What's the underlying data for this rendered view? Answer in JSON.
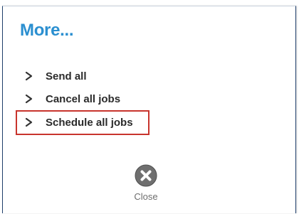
{
  "dialog": {
    "title": "More...",
    "items": [
      {
        "label": "Send all"
      },
      {
        "label": "Cancel all jobs"
      },
      {
        "label": "Schedule all jobs",
        "highlighted": true
      }
    ],
    "close_label": "Close",
    "icons": {
      "item": "chevron-right-icon",
      "close": "close-circle-icon"
    },
    "colors": {
      "title": "#2b8fd0",
      "highlight_border": "#c8342d",
      "close_circle": "#6f6f6f"
    }
  }
}
